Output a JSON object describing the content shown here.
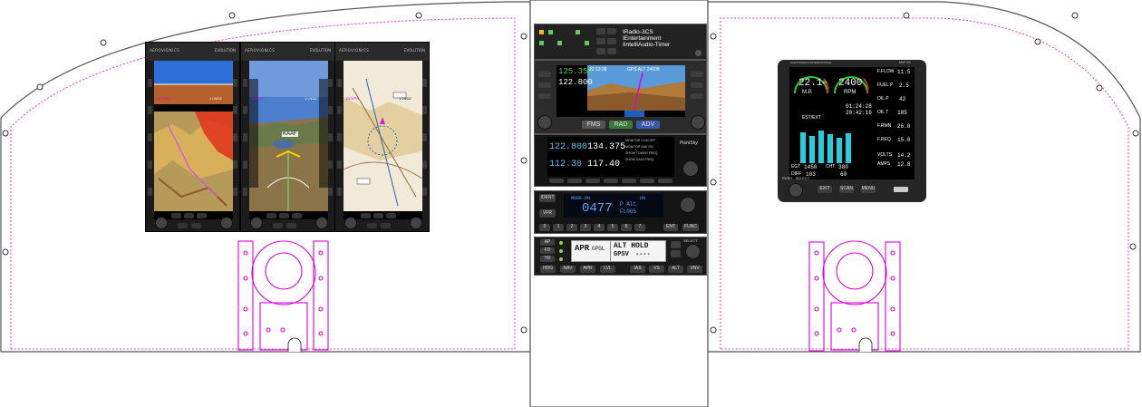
{
  "efis": {
    "brand": "AEROVIONICS",
    "model": "EVOLUTION",
    "screens": [
      {
        "top_left": "DCVPR",
        "top_right": "1 LNDZ"
      },
      {
        "top_left": "DCVPR",
        "top_right": "1 LNDZ",
        "waypoint": "KAAF"
      },
      {
        "top_left": "DCVPR",
        "top_right": "1 LNDZ"
      }
    ]
  },
  "audio_panel": {
    "line1": "IRadio-3CS",
    "line2": "IEntertainment",
    "line3": "IIntelliAudio-Timer"
  },
  "gtn": {
    "com_active": "125.350",
    "com_standby": "122.800",
    "time": "22:13:38",
    "gps_alt": "GPS ALT 2400ft",
    "buttons": [
      "FMS",
      "RAD",
      "ADV"
    ]
  },
  "navcom": {
    "com_active": "122.800",
    "com_standby": "134.375",
    "nav_active": "112.30",
    "nav_standby": "117.40",
    "monitor_lines": [
      "MONITOR COM OFF",
      "MONITOR NAV ON",
      "SHOW TOWER FREQ",
      "SHOW DATA FREQ"
    ],
    "brand": "PointSky"
  },
  "transponder": {
    "mode": "MODE-ON",
    "code": "0477",
    "on": "ON",
    "alt_label": "P Alt",
    "flight_level": "FL005",
    "ident": "IDENT",
    "vfr": "VFR",
    "digits": [
      "0",
      "1",
      "2",
      "3",
      "4",
      "5",
      "6",
      "7"
    ],
    "ent": "ENT",
    "func": "FUNC"
  },
  "autopilot": {
    "lateral_mode": "APR",
    "lateral_sub": "GPGL",
    "vertical_mode": "ALT HOLD",
    "vertical_sub": "GPSV",
    "vertical_value": "----",
    "left_buttons": [
      "AP",
      "FD",
      "YD"
    ],
    "bottom_buttons": [
      "HDG",
      "NAV",
      "APR",
      "LVL",
      "IAS",
      "VS",
      "ALT",
      "VNV"
    ],
    "select_label": "SELECT"
  },
  "ems": {
    "brand": "ELECTRONICS INTERNATIONAL",
    "model": "MVP-50",
    "mp_value": "22.1",
    "mp_unit": "IN",
    "mp_label": "M.P.",
    "rpm_value": "2400",
    "rpm_label": "RPM",
    "right_rows": [
      {
        "label": "F.FLOW",
        "value": "11.5"
      },
      {
        "label": "FUEL P",
        "value": "2.5"
      },
      {
        "label": "OIL P",
        "value": "42"
      },
      {
        "label": "OIL T",
        "value": "185"
      },
      {
        "label": "F.RMN",
        "value": "26.0"
      },
      {
        "label": "F.REQ",
        "value": "15.0"
      },
      {
        "label": "VOLTS",
        "value": "14.2"
      },
      {
        "label": "AMPS",
        "value": "12.8"
      }
    ],
    "timer1": "01:24:28",
    "timer2": "20:42:16",
    "est": "EST/EXT",
    "egt": "EGT",
    "egt_value": "1450",
    "cht": "CHT",
    "cht_value": "380",
    "diff": "DIFF",
    "diff_value": "103",
    "diff2_value": "60",
    "buttons": [
      "PUSH - SELECT",
      "EXIT",
      "SCAN",
      "MENU"
    ]
  },
  "colors": {
    "outline": "#555555",
    "dotted": "#e64ae0",
    "magenta": "#e000e0"
  }
}
